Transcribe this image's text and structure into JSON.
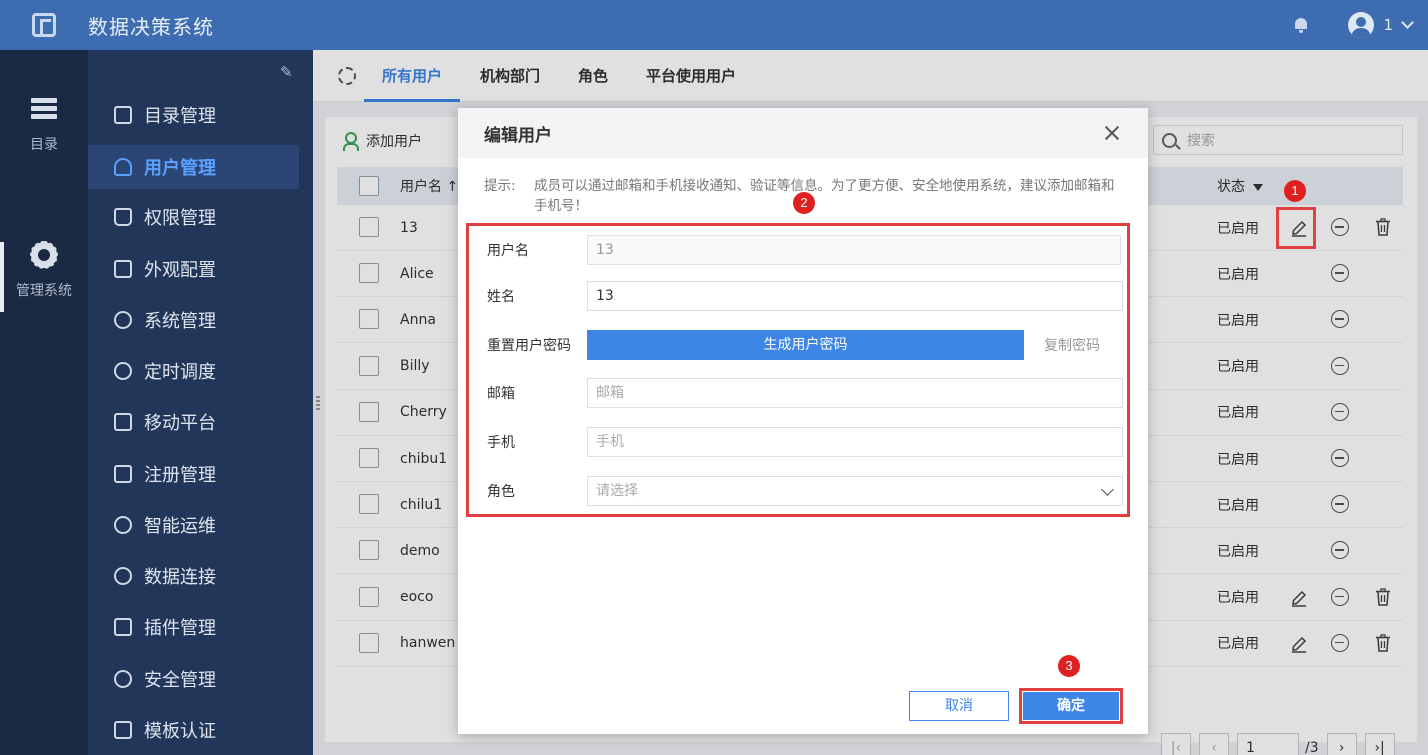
{
  "app": {
    "title": "数据决策系统",
    "user_num": "1"
  },
  "rail": [
    {
      "label": "目录",
      "icon": "list-icon"
    },
    {
      "label": "管理系统",
      "icon": "gear-icon"
    }
  ],
  "menu": [
    {
      "label": "目录管理",
      "icon": "catalog-icon"
    },
    {
      "label": "用户管理",
      "icon": "user-icon",
      "active": true
    },
    {
      "label": "权限管理",
      "icon": "lock-icon"
    },
    {
      "label": "外观配置",
      "icon": "brush-icon"
    },
    {
      "label": "系统管理",
      "icon": "gear-icon"
    },
    {
      "label": "定时调度",
      "icon": "timer-icon"
    },
    {
      "label": "移动平台",
      "icon": "mobile-icon"
    },
    {
      "label": "注册管理",
      "icon": "register-icon"
    },
    {
      "label": "智能运维",
      "icon": "network-icon"
    },
    {
      "label": "数据连接",
      "icon": "link-icon"
    },
    {
      "label": "插件管理",
      "icon": "plugin-icon"
    },
    {
      "label": "安全管理",
      "icon": "shield-icon"
    },
    {
      "label": "模板认证",
      "icon": "template-icon"
    }
  ],
  "tabs": [
    "所有用户",
    "机构部门",
    "角色",
    "平台使用用户"
  ],
  "toolbar": {
    "add_user": "添加用户",
    "search_placeholder": "搜索"
  },
  "table": {
    "col_username": "用户名 ↑",
    "col_status": "状态",
    "rows": [
      {
        "name": "13",
        "status": "已启用",
        "edit": true,
        "delete": true
      },
      {
        "name": "Alice",
        "status": "已启用",
        "edit": false,
        "delete": false
      },
      {
        "name": "Anna",
        "status": "已启用",
        "edit": false,
        "delete": false
      },
      {
        "name": "Billy",
        "status": "已启用",
        "edit": false,
        "delete": false
      },
      {
        "name": "Cherry",
        "status": "已启用",
        "edit": false,
        "delete": false
      },
      {
        "name": "chibu1",
        "status": "已启用",
        "edit": false,
        "delete": false
      },
      {
        "name": "chilu1",
        "status": "已启用",
        "edit": false,
        "delete": false
      },
      {
        "name": "demo",
        "status": "已启用",
        "edit": false,
        "delete": false
      },
      {
        "name": "eoco",
        "status": "已启用",
        "edit": true,
        "delete": true
      },
      {
        "name": "hanwen",
        "status": "已启用",
        "edit": true,
        "delete": true
      }
    ]
  },
  "pager": {
    "page": "1",
    "total": "/3"
  },
  "dialog": {
    "title": "编辑用户",
    "tip_label": "提示:",
    "tip_text": "成员可以通过邮箱和手机接收通知、验证等信息。为了更方便、安全地使用系统，建议添加邮箱和手机号！",
    "fields": {
      "username_label": "用户名",
      "username_value": "13",
      "name_label": "姓名",
      "name_value": "13",
      "reset_label": "重置用户密码",
      "generate_btn": "生成用户密码",
      "copy_link": "复制密码",
      "email_label": "邮箱",
      "email_placeholder": "邮箱",
      "phone_label": "手机",
      "phone_placeholder": "手机",
      "role_label": "角色",
      "role_placeholder": "请选择"
    },
    "cancel": "取消",
    "ok": "确定"
  },
  "badges": [
    "1",
    "2",
    "3"
  ],
  "colors": {
    "topbar": "#3d6db0",
    "accent": "#3d86e8",
    "highlight": "#e04040",
    "sidebar": "#22365a"
  }
}
